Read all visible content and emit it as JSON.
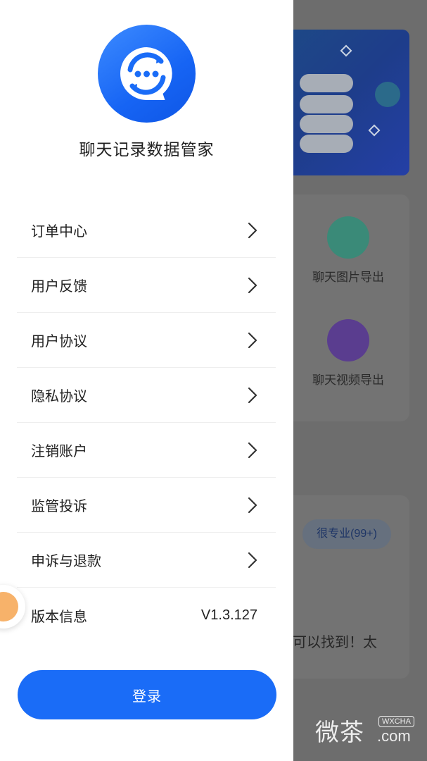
{
  "colors": {
    "primary": "#1a6cf7",
    "overlay": "#6d6d6d",
    "text": "#222222",
    "divider": "#eeeeee"
  },
  "drawer": {
    "logo_icon": "chat-bubble-sync-icon",
    "app_name": "聊天记录数据管家",
    "menu": [
      {
        "label": "订单中心",
        "icon": "chevron-right-icon"
      },
      {
        "label": "用户反馈",
        "icon": "chevron-right-icon"
      },
      {
        "label": "用户协议",
        "icon": "chevron-right-icon"
      },
      {
        "label": "隐私协议",
        "icon": "chevron-right-icon"
      },
      {
        "label": "注销账户",
        "icon": "chevron-right-icon"
      },
      {
        "label": "监管投诉",
        "icon": "chevron-right-icon"
      },
      {
        "label": "申诉与退款",
        "icon": "chevron-right-icon"
      }
    ],
    "version": {
      "label": "版本信息",
      "value": "V1.3.127"
    },
    "login_label": "登录"
  },
  "background": {
    "tools": [
      {
        "label": "聊天图片导出",
        "icon": "image-icon",
        "color": "#3a8a78"
      },
      {
        "label": "聊天视频导出",
        "icon": "video-icon",
        "color": "#5a3d8f"
      }
    ],
    "review_tag": "很专业(99+)",
    "review_text": "可以找到！太",
    "watermark": {
      "text": "微茶",
      "tag": "WXCHA",
      "domain": ".com"
    }
  }
}
